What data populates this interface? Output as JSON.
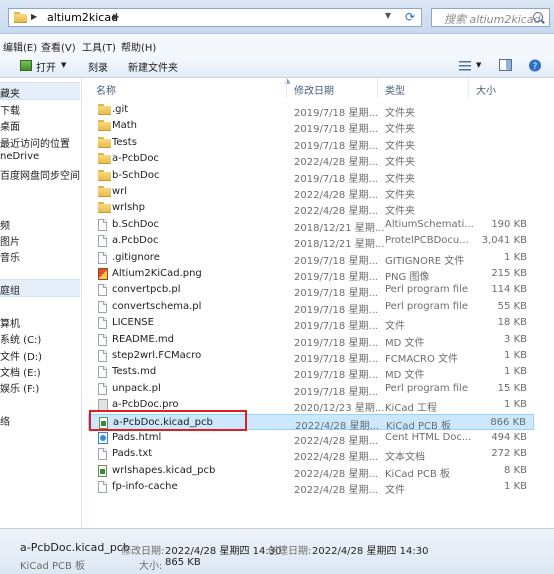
{
  "address": {
    "path": "altium2kicad",
    "search_placeholder": "搜索 altium2kicad"
  },
  "menu": {
    "items": [
      "编辑(E)",
      "查看(V)",
      "工具(T)",
      "帮助(H)"
    ]
  },
  "toolbar": {
    "open_label": "打开",
    "open_arrow": "▼",
    "burn_label": "刻录",
    "new_folder_label": "新建文件夹"
  },
  "nav": {
    "items": [
      "藏夹",
      "下载",
      "桌面",
      "最近访问的位置",
      "neDrive",
      "百度网盘同步空间",
      "频",
      "图片",
      "音乐",
      "庭组",
      "算机",
      "系统 (C:)",
      "文件 (D:)",
      "文档 (E:)",
      "娱乐 (F:)",
      "络"
    ]
  },
  "columns": {
    "name": "名称",
    "modified": "修改日期",
    "type": "类型",
    "size": "大小"
  },
  "files": [
    {
      "name": ".git",
      "date": "2019/7/18 星期...",
      "type": "文件夹",
      "size": "",
      "icon": "folder"
    },
    {
      "name": "Math",
      "date": "2019/7/18 星期...",
      "type": "文件夹",
      "size": "",
      "icon": "folder"
    },
    {
      "name": "Tests",
      "date": "2019/7/18 星期...",
      "type": "文件夹",
      "size": "",
      "icon": "folder"
    },
    {
      "name": "a-PcbDoc",
      "date": "2022/4/28 星期...",
      "type": "文件夹",
      "size": "",
      "icon": "folder"
    },
    {
      "name": "b-SchDoc",
      "date": "2019/7/18 星期...",
      "type": "文件夹",
      "size": "",
      "icon": "folder"
    },
    {
      "name": "wrl",
      "date": "2022/4/28 星期...",
      "type": "文件夹",
      "size": "",
      "icon": "folder"
    },
    {
      "name": "wrlshp",
      "date": "2022/4/28 星期...",
      "type": "文件夹",
      "size": "",
      "icon": "folder"
    },
    {
      "name": "b.SchDoc",
      "date": "2018/12/21 星期...",
      "type": "AltiumSchemati...",
      "size": "190 KB",
      "icon": "file"
    },
    {
      "name": "a.PcbDoc",
      "date": "2018/12/21 星期...",
      "type": "ProtelPCBDocu...",
      "size": "3,041 KB",
      "icon": "file"
    },
    {
      "name": ".gitignore",
      "date": "2019/7/18 星期...",
      "type": "GITIGNORE 文件",
      "size": "1 KB",
      "icon": "file"
    },
    {
      "name": "Altium2KiCad.png",
      "date": "2019/7/18 星期...",
      "type": "PNG 图像",
      "size": "215 KB",
      "icon": "png"
    },
    {
      "name": "convertpcb.pl",
      "date": "2019/7/18 星期...",
      "type": "Perl program file",
      "size": "114 KB",
      "icon": "file"
    },
    {
      "name": "convertschema.pl",
      "date": "2019/7/18 星期...",
      "type": "Perl program file",
      "size": "55 KB",
      "icon": "file"
    },
    {
      "name": "LICENSE",
      "date": "2019/7/18 星期...",
      "type": "文件",
      "size": "18 KB",
      "icon": "file"
    },
    {
      "name": "README.md",
      "date": "2019/7/18 星期...",
      "type": "MD 文件",
      "size": "3 KB",
      "icon": "file"
    },
    {
      "name": "step2wrl.FCMacro",
      "date": "2019/7/18 星期...",
      "type": "FCMACRO 文件",
      "size": "1 KB",
      "icon": "file"
    },
    {
      "name": "Tests.md",
      "date": "2019/7/18 星期...",
      "type": "MD 文件",
      "size": "1 KB",
      "icon": "file"
    },
    {
      "name": "unpack.pl",
      "date": "2019/7/18 星期...",
      "type": "Perl program file",
      "size": "15 KB",
      "icon": "file"
    },
    {
      "name": "a-PcbDoc.pro",
      "date": "2020/12/23 星期...",
      "type": "KiCad 工程",
      "size": "1 KB",
      "icon": "pro"
    },
    {
      "name": "a-PcbDoc.kicad_pcb",
      "date": "2022/4/28 星期...",
      "type": "KiCad PCB 板",
      "size": "866 KB",
      "icon": "kicad",
      "selected": true
    },
    {
      "name": "Pads.html",
      "date": "2022/4/28 星期...",
      "type": "Cent HTML Doc...",
      "size": "494 KB",
      "icon": "html"
    },
    {
      "name": "Pads.txt",
      "date": "2022/4/28 星期...",
      "type": "文本文档",
      "size": "272 KB",
      "icon": "file"
    },
    {
      "name": "wrlshapes.kicad_pcb",
      "date": "2022/4/28 星期...",
      "type": "KiCad PCB 板",
      "size": "8 KB",
      "icon": "kicad"
    },
    {
      "name": "fp-info-cache",
      "date": "2022/4/28 星期...",
      "type": "文件",
      "size": "1 KB",
      "icon": "file"
    }
  ],
  "status": {
    "file_name": "a-PcbDoc.kicad_pcb",
    "modified_label": "修改日期:",
    "modified_value": "2022/4/28 星期四 14:30",
    "created_label": "创建日期:",
    "created_value": "2022/4/28 星期四 14:30",
    "file_type": "KiCad PCB 板",
    "size_label": "大小:",
    "size_value": "865 KB"
  },
  "colors": {
    "selection": "#cce8ff",
    "highlight_box": "#e02020"
  }
}
